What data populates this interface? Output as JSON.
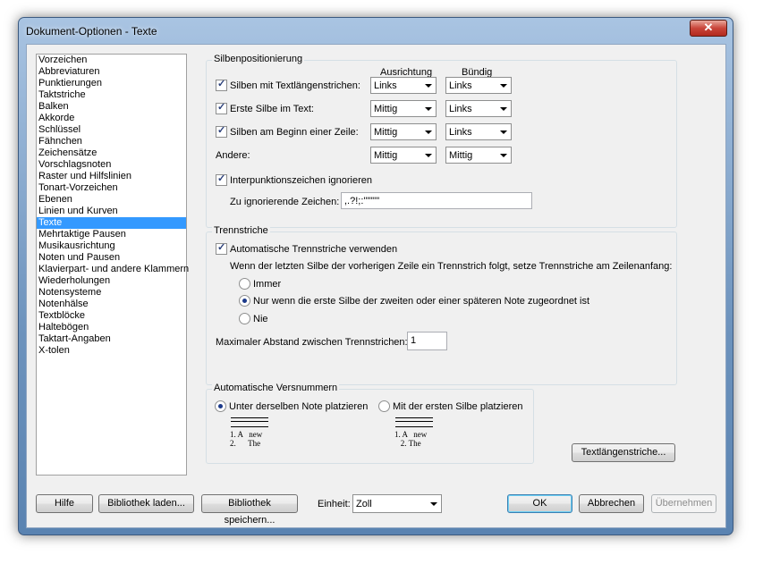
{
  "window": {
    "title": "Dokument-Optionen - Texte",
    "close": "✕"
  },
  "sidebar": {
    "items": [
      "Vorzeichen",
      "Abbreviaturen",
      "Punktierungen",
      "Taktstriche",
      "Balken",
      "Akkorde",
      "Schlüssel",
      "Fähnchen",
      "Zeichensätze",
      "Vorschlagsnoten",
      "Raster und Hilfslinien",
      "Tonart-Vorzeichen",
      "Ebenen",
      "Linien und Kurven",
      "Texte",
      "Mehrtaktige Pausen",
      "Musikausrichtung",
      "Noten und Pausen",
      "Klavierpart- und andere Klammern",
      "Wiederholungen",
      "Notensysteme",
      "Notenhälse",
      "Textblöcke",
      "Haltebögen",
      "Taktart-Angaben",
      "X-tolen"
    ],
    "selected": "Texte"
  },
  "silben": {
    "legend": "Silbenpositionierung",
    "col_ausrichtung": "Ausrichtung",
    "col_buendig": "Bündig",
    "rows": [
      {
        "label": "Silben mit Textlängenstrichen:",
        "checked": true,
        "ausrichtung": "Links",
        "buendig": "Links"
      },
      {
        "label": "Erste Silbe im Text:",
        "checked": true,
        "ausrichtung": "Mittig",
        "buendig": "Links"
      },
      {
        "label": "Silben am Beginn einer Zeile:",
        "checked": true,
        "ausrichtung": "Mittig",
        "buendig": "Links"
      },
      {
        "label": "Andere:",
        "checked": null,
        "ausrichtung": "Mittig",
        "buendig": "Mittig"
      }
    ],
    "interpunktion_label": "Interpunktionszeichen ignorieren",
    "interpunktion_checked": true,
    "ignore_label": "Zu ignorierende Zeichen:",
    "ignore_value": ",.?!;:'\"\"\"\""
  },
  "trenn": {
    "legend": "Trennstriche",
    "auto_label": "Automatische Trennstriche verwenden",
    "auto_checked": true,
    "desc": "Wenn der letzten Silbe der vorherigen Zeile ein Trennstrich folgt, setze Trennstriche am Zeilenanfang:",
    "options": [
      "Immer",
      "Nur wenn die erste Silbe der zweiten oder einer späteren Note zugeordnet ist",
      "Nie"
    ],
    "selected_index": 1,
    "max_label": "Maximaler Abstand zwischen Trennstrichen:",
    "max_value": "1"
  },
  "vers": {
    "legend": "Automatische Versnummern",
    "opt1": "Unter derselben Note platzieren",
    "opt2": "Mit der ersten Silbe platzieren",
    "selected": 0,
    "ex1_line1": "1. A   new",
    "ex1_line2": "2.      The",
    "ex2_line1": "1. A   new",
    "ex2_line2": "   2. The"
  },
  "buttons": {
    "textlaengen": "Textlängenstriche...",
    "hilfe": "Hilfe",
    "laden": "Bibliothek laden...",
    "speichern": "Bibliothek speichern...",
    "einheit_label": "Einheit:",
    "einheit_value": "Zoll",
    "ok": "OK",
    "abbrechen": "Abbrechen",
    "uebernehmen": "Übernehmen"
  }
}
